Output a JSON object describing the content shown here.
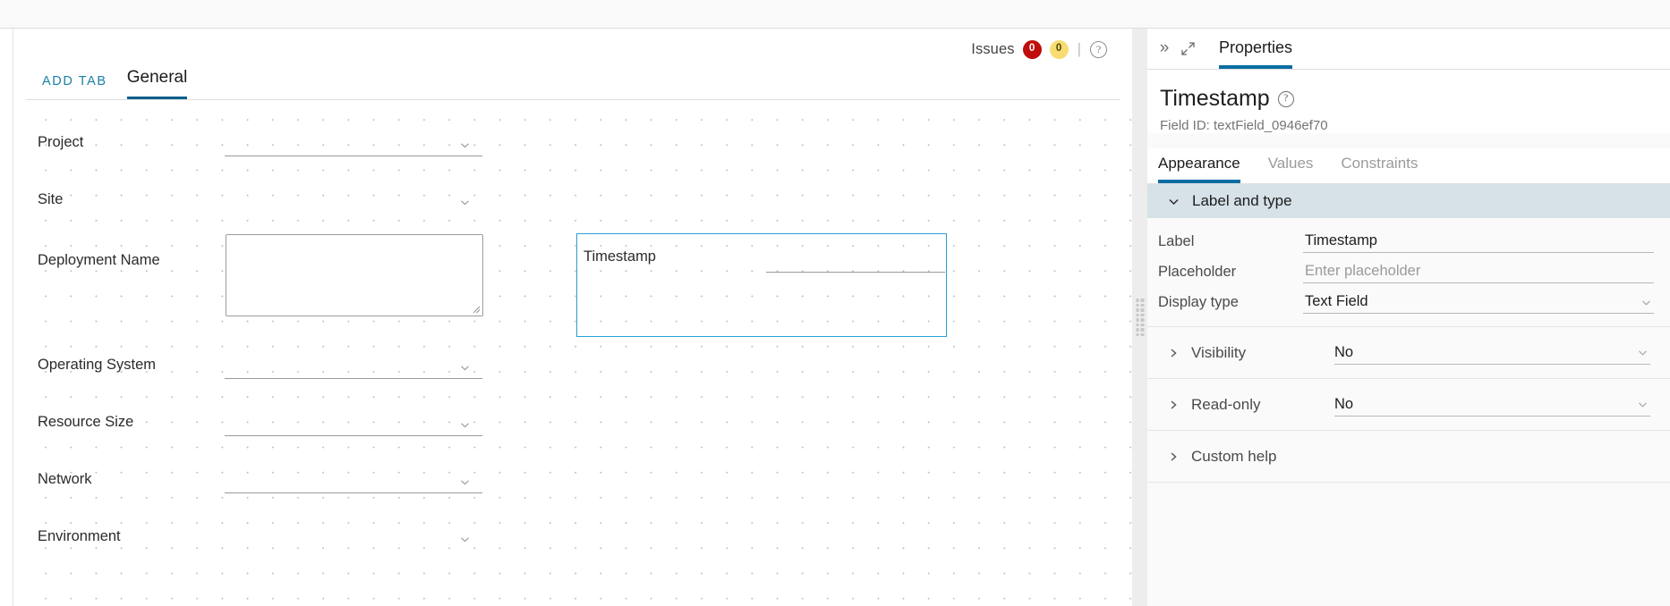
{
  "builder": {
    "issues": {
      "label": "Issues",
      "error_count": "0",
      "warning_count": "0",
      "separator": "|",
      "help_glyph": "?",
      "error_color": "#c00c0c",
      "warning_color": "#f8db72"
    },
    "tabs": {
      "add_tab_label": "ADD TAB",
      "active_tab_label": "General"
    },
    "fields": [
      {
        "label": "Project",
        "control": "dropdown"
      },
      {
        "label": "Site",
        "control": "dropdown"
      },
      {
        "label": "Deployment Name",
        "control": "textarea"
      },
      {
        "label": "Timestamp",
        "control": "dropdown",
        "selected": true
      },
      {
        "label": "Operating System",
        "control": "dropdown"
      },
      {
        "label": "Resource Size",
        "control": "dropdown"
      },
      {
        "label": "Network",
        "control": "dropdown"
      },
      {
        "label": "Environment",
        "control": "dropdown"
      }
    ]
  },
  "properties": {
    "collapse_icon": "»",
    "expand_icon": "expand-diagonal",
    "panel_tab": "Properties",
    "title": "Timestamp",
    "title_help_glyph": "?",
    "field_id": "Field ID: textField_0946ef70",
    "subtabs": [
      {
        "label": "Appearance",
        "active": true
      },
      {
        "label": "Values",
        "active": false
      },
      {
        "label": "Constraints",
        "active": false
      }
    ],
    "section": {
      "title": "Label and type",
      "expanded": true,
      "header_color": "#d6e1e8"
    },
    "rows": [
      {
        "key": "Label",
        "value": "Timestamp",
        "is_placeholder": false,
        "dropdown": false
      },
      {
        "key": "Placeholder",
        "value": "Enter placeholder",
        "is_placeholder": true,
        "dropdown": false
      },
      {
        "key": "Display type",
        "value": "Text Field",
        "is_placeholder": false,
        "dropdown": true
      }
    ],
    "accordions": [
      {
        "label": "Visibility",
        "value": "No",
        "has_value": true
      },
      {
        "label": "Read-only",
        "value": "No",
        "has_value": true
      },
      {
        "label": "Custom help",
        "value": "",
        "has_value": false
      }
    ],
    "accent_color": "#0a6ea3"
  }
}
